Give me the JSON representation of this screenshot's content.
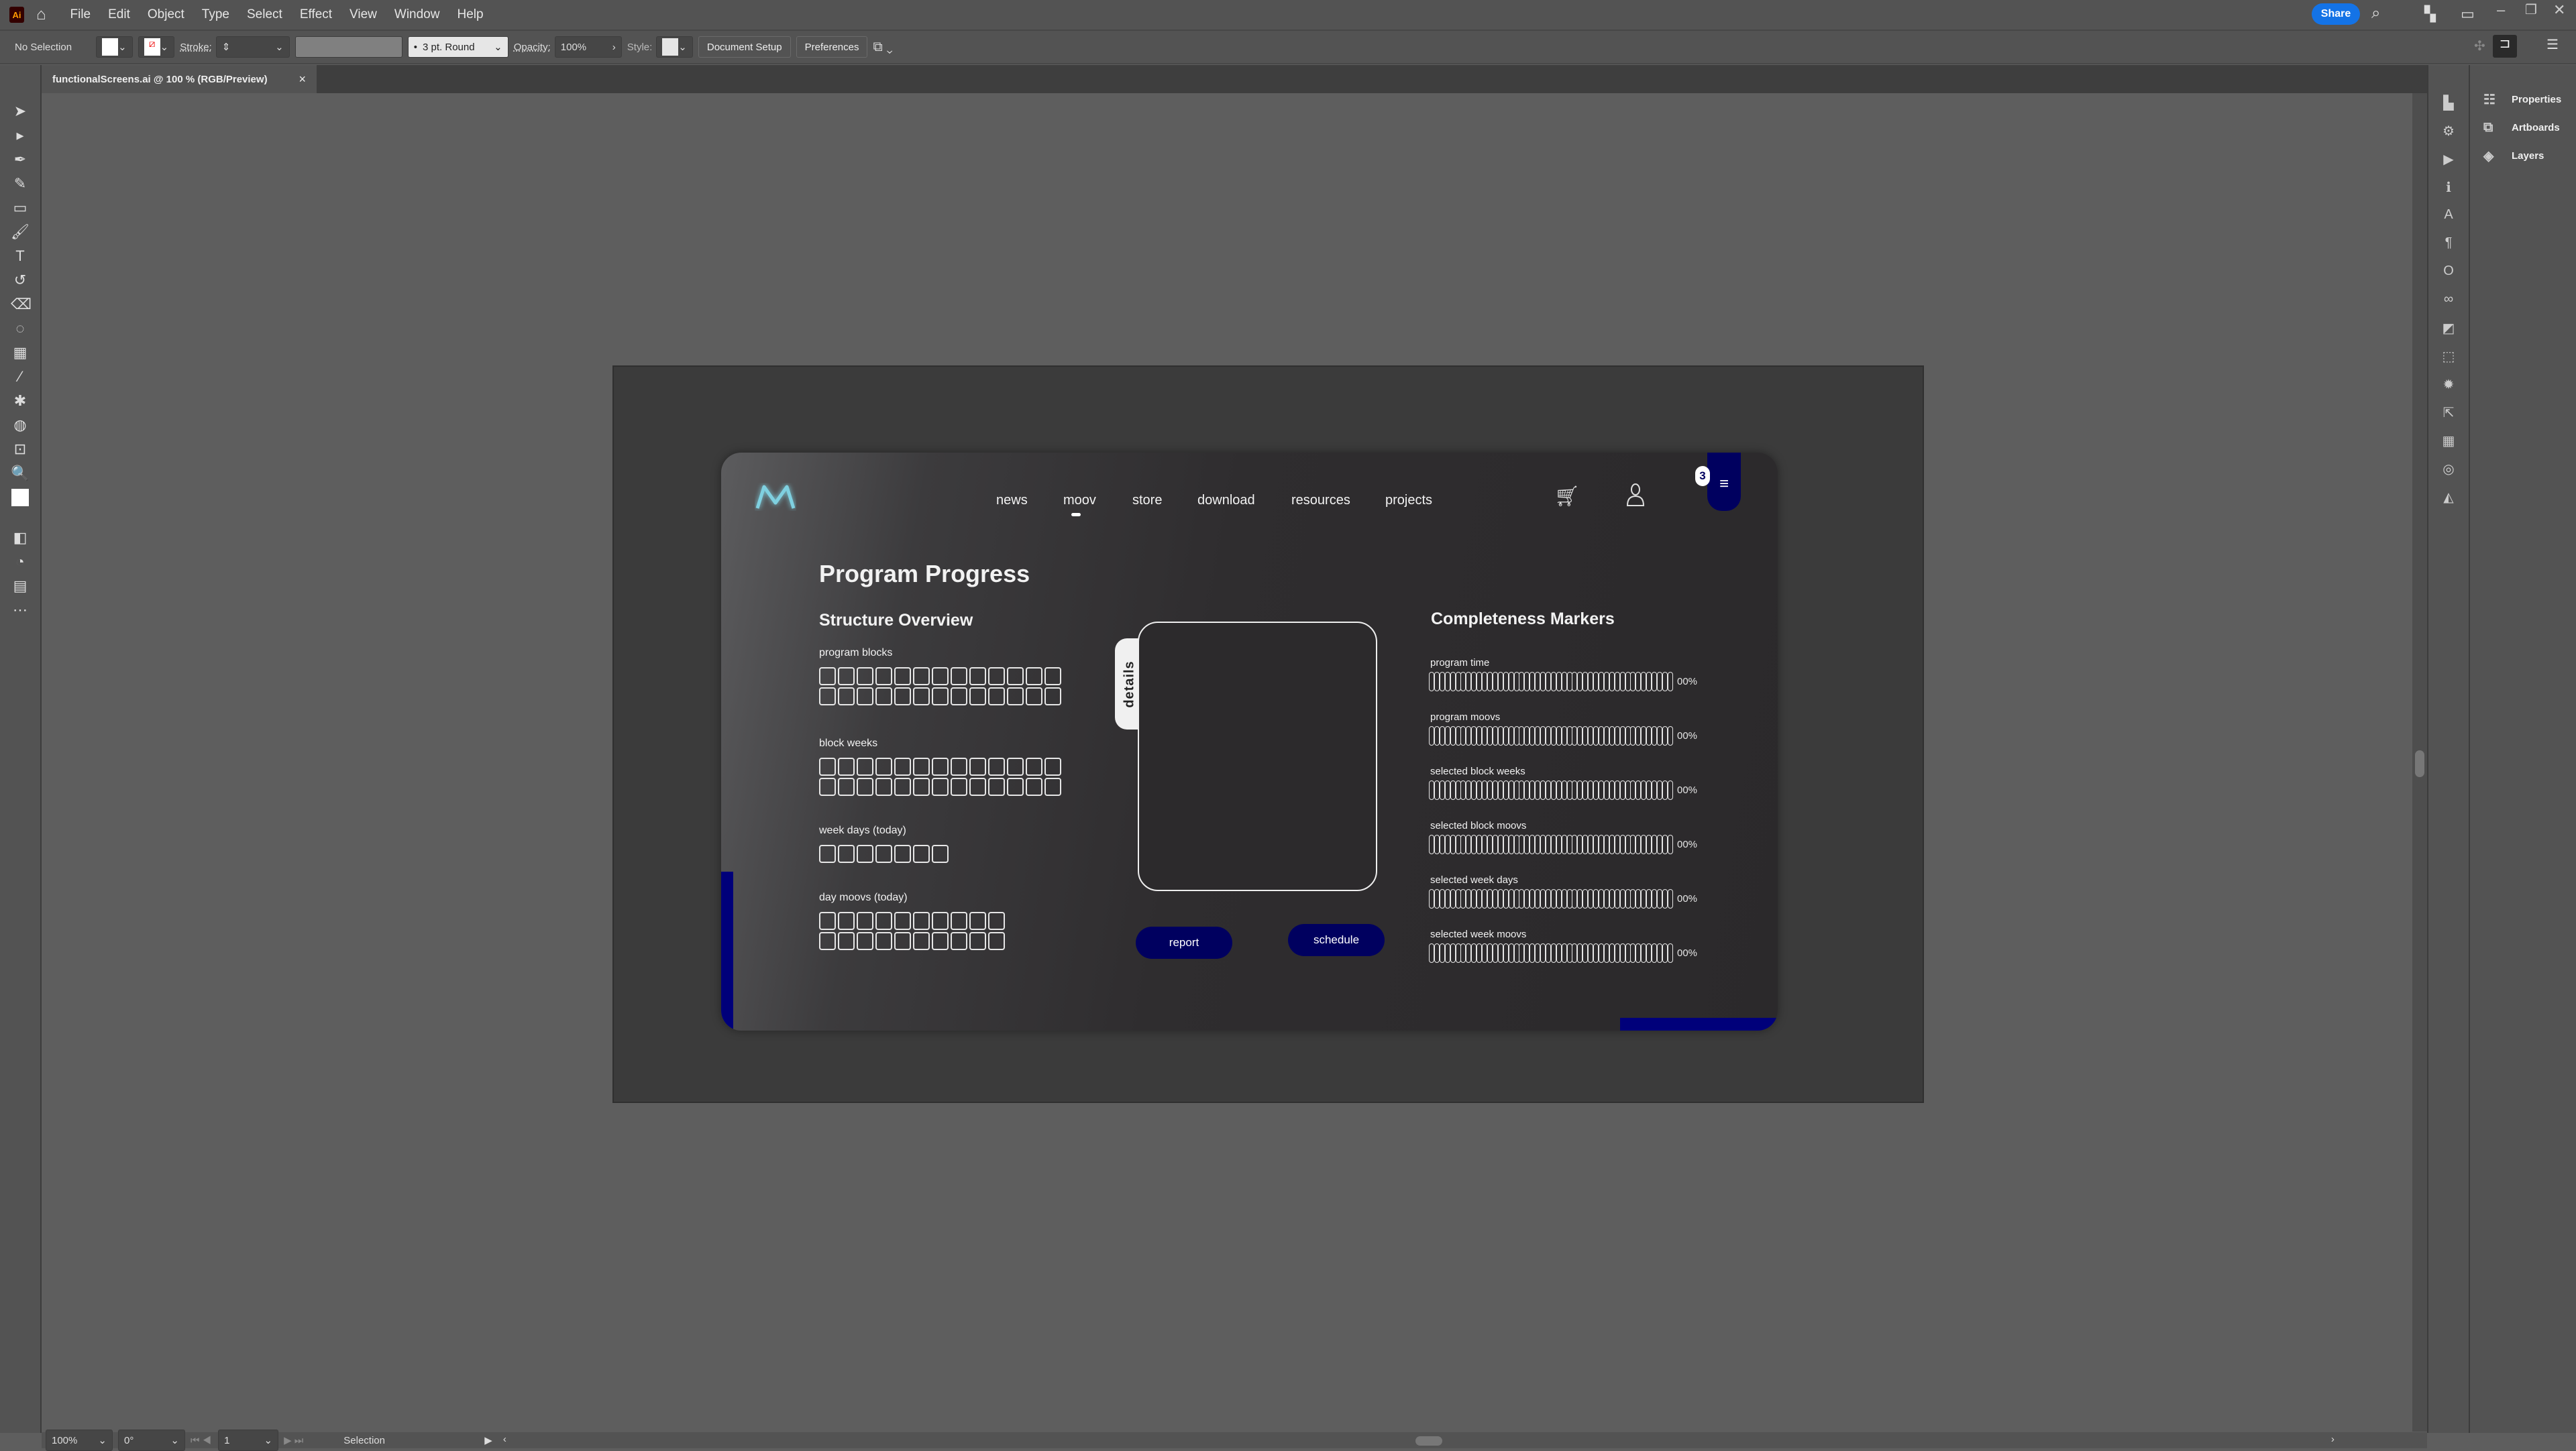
{
  "app": {
    "menu": [
      "File",
      "Edit",
      "Object",
      "Type",
      "Select",
      "Effect",
      "View",
      "Window",
      "Help"
    ],
    "share": "Share",
    "logo": "Ai"
  },
  "control": {
    "selection": "No Selection",
    "stroke_label": "Stroke:",
    "brush": "3 pt. Round",
    "opacity_label": "Opacity:",
    "opacity": "100%",
    "style_label": "Style:",
    "doc_setup": "Document Setup",
    "preferences": "Preferences"
  },
  "tab": {
    "title": "functionalScreens.ai @ 100 % (RGB/Preview)",
    "close": "×"
  },
  "panels": [
    {
      "label": "Properties",
      "icon": "sliders-icon"
    },
    {
      "label": "Artboards",
      "icon": "artboards-icon"
    },
    {
      "label": "Layers",
      "icon": "layers-icon"
    }
  ],
  "status": {
    "zoom": "100%",
    "rotation": "0°",
    "artboard": "1",
    "tool": "Selection"
  },
  "colors": {
    "accent": "#00005f",
    "logo": "#7fd0e0"
  },
  "site": {
    "nav": [
      "news",
      "moov",
      "store",
      "download",
      "resources",
      "projects"
    ],
    "active_nav": "moov",
    "badge": "3",
    "title": "Program Progress",
    "structure": {
      "heading": "Structure Overview",
      "groups": [
        {
          "label": "program blocks",
          "cols": 13,
          "rows": 2
        },
        {
          "label": "block weeks",
          "cols": 13,
          "rows": 2
        },
        {
          "label": "week days (today)",
          "cols": 7,
          "rows": 1
        },
        {
          "label": "day moovs (today)",
          "cols": 10,
          "rows": 2
        }
      ]
    },
    "details_tab": "details",
    "report": "report",
    "schedule": "schedule",
    "markers": {
      "heading": "Completeness Markers",
      "items": [
        {
          "label": "program time",
          "value": "00%"
        },
        {
          "label": "program moovs",
          "value": "00%"
        },
        {
          "label": "selected block weeks",
          "value": "00%"
        },
        {
          "label": "selected block moovs",
          "value": "00%"
        },
        {
          "label": "selected week days",
          "value": "00%"
        },
        {
          "label": "selected week moovs",
          "value": "00%"
        }
      ]
    }
  }
}
